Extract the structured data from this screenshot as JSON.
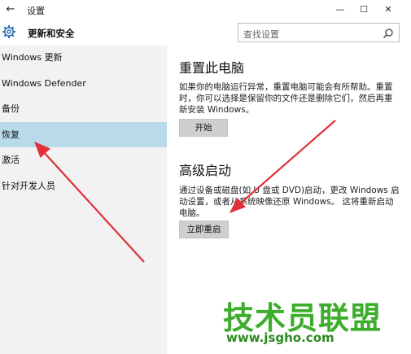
{
  "window": {
    "title": "设置",
    "back_icon": "arrow-left-icon",
    "min_glyph": "—",
    "max_glyph": "☐",
    "close_glyph": "✕"
  },
  "header": {
    "section_title": "更新和安全",
    "search_placeholder": "查找设置"
  },
  "sidebar": {
    "items": [
      {
        "label": "Windows 更新"
      },
      {
        "label": "Windows Defender"
      },
      {
        "label": "备份"
      },
      {
        "label": "恢复",
        "active": true
      },
      {
        "label": "激活"
      },
      {
        "label": "针对开发人员"
      }
    ]
  },
  "main": {
    "reset": {
      "heading": "重置此电脑",
      "desc": "如果你的电脑运行异常，重置电脑可能会有所帮助。重置时，你可以选择是保留你的文件还是删除它们，然后再重新安装 Windows。",
      "button": "开始"
    },
    "advanced": {
      "heading": "高级启动",
      "desc": "通过设备或磁盘(如 U 盘或 DVD)启动，更改 Windows 启动设置，或者从系统映像还原 Windows。 这将重新启动电脑。",
      "button": "立即重启"
    }
  },
  "watermark": {
    "brand": "技术员联盟",
    "url": "www.jsgho.com"
  },
  "colors": {
    "sidebar_bg": "#f2f2f2",
    "active_bg": "#b9dbe9",
    "button_bg": "#cfcfcf",
    "arrow": "#e0303a",
    "watermark": "#3dae2b"
  }
}
